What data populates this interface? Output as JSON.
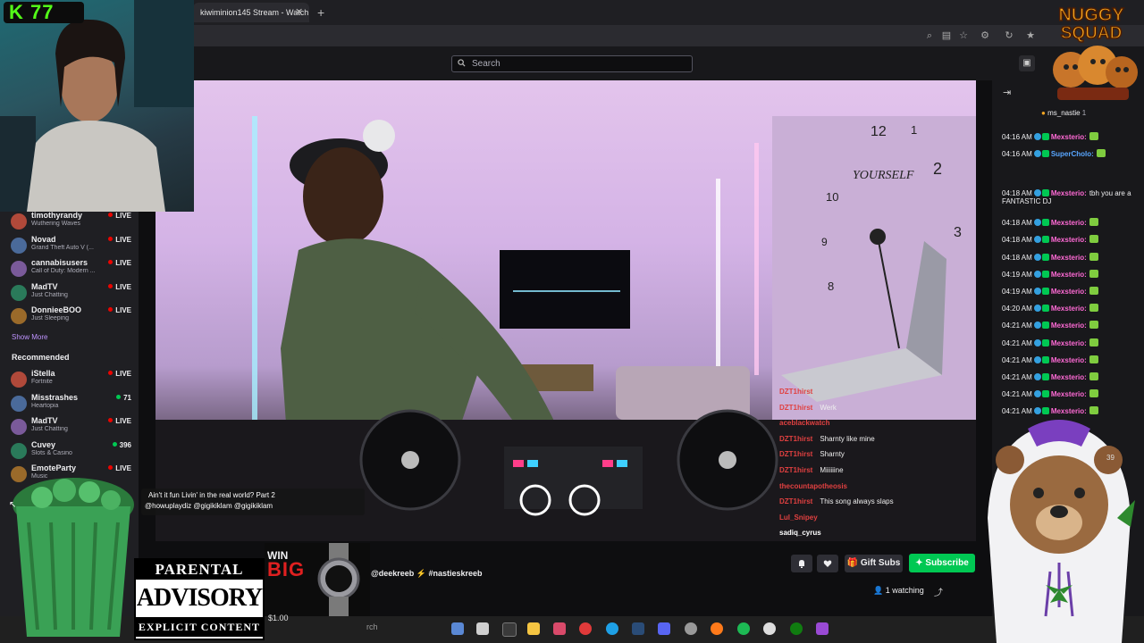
{
  "browser": {
    "tab_title": "kiwiminion145 Stream - Watch",
    "tab_close": "✕",
    "new_tab": "+"
  },
  "topnav": {
    "search_placeholder": "Search"
  },
  "sidebar": {
    "followed": [
      {
        "name": "timothyrandy",
        "game": "Wuthering Waves",
        "status": "LIVE"
      },
      {
        "name": "Novad",
        "game": "Grand Theft Auto V (...",
        "status": "LIVE"
      },
      {
        "name": "cannabisusers",
        "game": "Call of Duty: Modern ...",
        "status": "LIVE"
      },
      {
        "name": "MadTV",
        "game": "Just Chatting",
        "status": "LIVE"
      },
      {
        "name": "DonnieeBOO",
        "game": "Just Sleeping",
        "status": "LIVE"
      }
    ],
    "show_more": "Show More",
    "recommended_heading": "Recommended",
    "recommended": [
      {
        "name": "iStella",
        "game": "Fortnite",
        "status": "LIVE"
      },
      {
        "name": "Misstrashes",
        "game": "Heartopia",
        "status": "71"
      },
      {
        "name": "MadTV",
        "game": "Just Chatting",
        "status": "LIVE"
      },
      {
        "name": "Cuvey",
        "game": "Slots & Casino",
        "status": "396"
      },
      {
        "name": "EmoteParty",
        "game": "Music",
        "status": "LIVE"
      }
    ]
  },
  "stream": {
    "song_line1": "Ain't it fun Livin' in the real world? Part 2",
    "song_line2": "@howuplaydiz @gigikiklam @gigikiklam",
    "tags": "@deekreeb  ⚡  #nastieskreeb",
    "gift_subs": "Gift Subs",
    "subscribe": "Subscribe",
    "viewers": "1 watching"
  },
  "video_chat": [
    {
      "user": "DZT1hirst",
      "text": "",
      "color": "#e04040"
    },
    {
      "user": "DZT1hirst",
      "text": "Werk",
      "color": "#e04040"
    },
    {
      "user": "aceblackwatch",
      "text": "",
      "color": "#e04040"
    },
    {
      "user": "DZT1hirst",
      "text": "Sharnty like mine",
      "color": "#e04040"
    },
    {
      "user": "DZT1hirst",
      "text": "Sharnty",
      "color": "#e04040"
    },
    {
      "user": "DZT1hirst",
      "text": "Miiiiiine",
      "color": "#e04040"
    },
    {
      "user": "thecountapotheosis",
      "text": "",
      "color": "#e04040"
    },
    {
      "user": "DZT1hirst",
      "text": "This song always slaps",
      "color": "#e04040"
    },
    {
      "user": "Lul_Snipey",
      "text": "",
      "color": "#e04040"
    },
    {
      "user": "sadiq_cyrus",
      "text": "",
      "color": "#ffffff"
    }
  ],
  "chat": {
    "pinned_user": "ms_nastie",
    "pinned_count": "1",
    "messages": [
      {
        "time": "04:16 AM",
        "user": "Mexsterio:",
        "text": "",
        "color": "#ff6ad5"
      },
      {
        "time": "04:16 AM",
        "user": "SuperCholo:",
        "text": "",
        "color": "#58a6ff"
      },
      {
        "time": "04:18 AM",
        "user": "Mexsterio:",
        "text": "tbh you are a FANTASTIC DJ",
        "color": "#ff6ad5"
      },
      {
        "time": "04:18 AM",
        "user": "Mexsterio:",
        "text": "",
        "color": "#ff6ad5"
      },
      {
        "time": "04:18 AM",
        "user": "Mexsterio:",
        "text": "",
        "color": "#ff6ad5"
      },
      {
        "time": "04:18 AM",
        "user": "Mexsterio:",
        "text": "",
        "color": "#ff6ad5"
      },
      {
        "time": "04:19 AM",
        "user": "Mexsterio:",
        "text": "",
        "color": "#ff6ad5"
      },
      {
        "time": "04:19 AM",
        "user": "Mexsterio:",
        "text": "",
        "color": "#ff6ad5"
      },
      {
        "time": "04:20 AM",
        "user": "Mexsterio:",
        "text": "",
        "color": "#ff6ad5"
      },
      {
        "time": "04:21 AM",
        "user": "Mexsterio:",
        "text": "",
        "color": "#ff6ad5"
      },
      {
        "time": "04:21 AM",
        "user": "Mexsterio:",
        "text": "",
        "color": "#ff6ad5"
      },
      {
        "time": "04:21 AM",
        "user": "Mexsterio:",
        "text": "",
        "color": "#ff6ad5"
      },
      {
        "time": "04:21 AM",
        "user": "Mexsterio:",
        "text": "",
        "color": "#ff6ad5"
      },
      {
        "time": "04:21 AM",
        "user": "Mexsterio:",
        "text": "",
        "color": "#ff6ad5"
      },
      {
        "time": "04:21 AM",
        "user": "Mexsterio:",
        "text": "",
        "color": "#ff6ad5"
      }
    ],
    "count_badge": "39"
  },
  "overlays": {
    "kick_count": "K 77",
    "nuggy_line1": "NUGGY",
    "nuggy_line2": "SQUAD",
    "advisory_line1": "PARENTAL",
    "advisory_line2": "ADVISORY",
    "advisory_line3": "EXPLICIT CONTENT",
    "win": "WIN",
    "big": "BIG",
    "price": "$1.00"
  },
  "taskbar": {
    "search_text": "rch"
  },
  "colors": {
    "accent": "#9147ff",
    "live": "#eb0400",
    "subscribe": "#00c853",
    "kick": "#53fc18"
  }
}
